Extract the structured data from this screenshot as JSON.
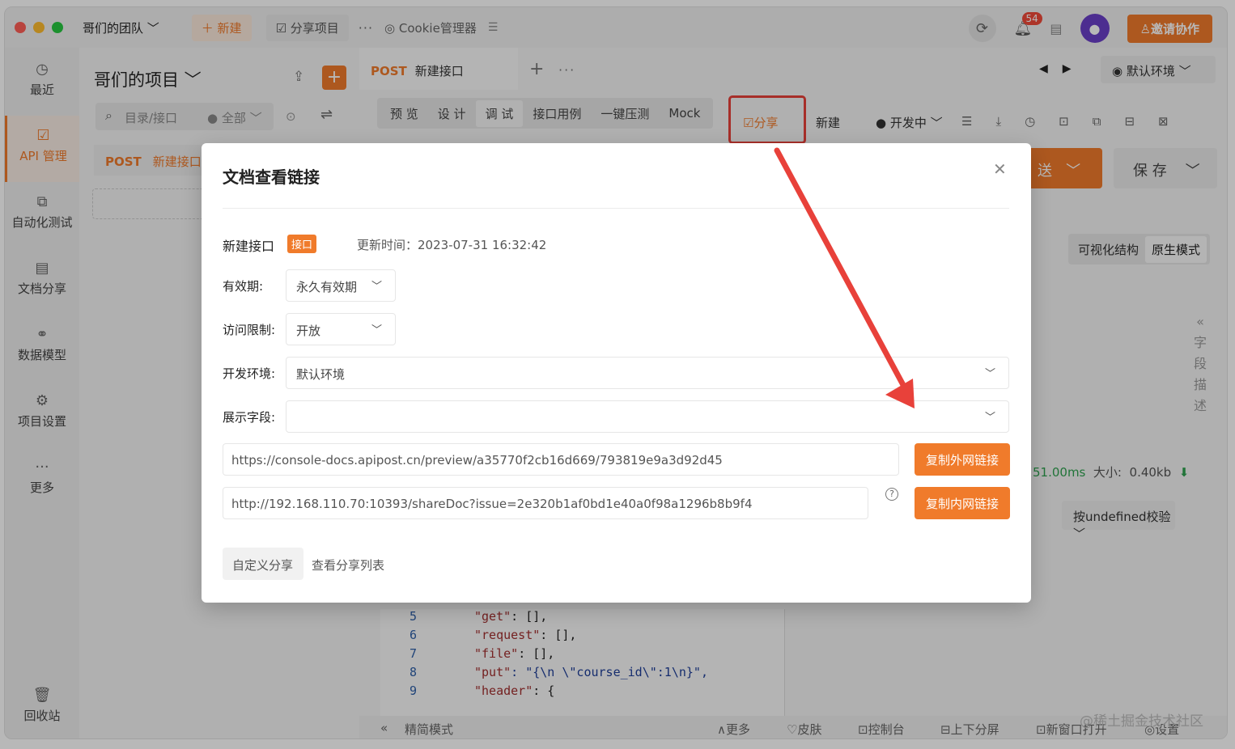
{
  "titlebar": {
    "team": "哥们的团队 ﹀",
    "new_label": "＋ 新建",
    "share_project": "☑ 分享项目",
    "more": "···",
    "cookie": "◎ Cookie管理器",
    "list_icon": "☰",
    "notifications": "54",
    "invite": "邀请协作"
  },
  "sidebar": {
    "items": [
      {
        "label": "最近",
        "icon": "clock-icon"
      },
      {
        "label": "API 管理",
        "icon": "edit-icon"
      },
      {
        "label": "自动化测试",
        "icon": "flow-icon"
      },
      {
        "label": "文档分享",
        "icon": "doc-icon"
      },
      {
        "label": "数据模型",
        "icon": "model-icon"
      },
      {
        "label": "项目设置",
        "icon": "settings-icon"
      },
      {
        "label": "更多",
        "icon": "more-icon"
      },
      {
        "label": "回收站",
        "icon": "trash-icon"
      }
    ]
  },
  "project": {
    "title": "哥们的项目 ﹀",
    "search_placeholder": "目录/接口",
    "filter": "● 全部 ﹀",
    "item_method": "POST",
    "item_name": "新建接口"
  },
  "main": {
    "tab_method": "POST",
    "tab_name": "新建接口",
    "env": "默认环境 ﹀",
    "subtabs": [
      "预 览",
      "设 计",
      "调 试",
      "接口用例",
      "一键压测",
      "Mock"
    ],
    "share": "分享",
    "new_short": "新建",
    "dev": "● 开发中 ﹀",
    "send": "送",
    "save": "保 存",
    "view_visual": "可视化结构",
    "view_raw": "原生模式",
    "field_desc": [
      "«",
      "字",
      "段",
      "描",
      "述"
    ],
    "time_value": "51.00ms",
    "size_label": "大小:",
    "size_value": "0.40kb",
    "validate": "按undefined校验 ﹀"
  },
  "code": {
    "lines": [
      {
        "n": "5",
        "key": "\"get\"",
        "rest": ": [],"
      },
      {
        "n": "6",
        "key": "\"request\"",
        "rest": ": [],"
      },
      {
        "n": "7",
        "key": "\"file\"",
        "rest": ": [],"
      },
      {
        "n": "8",
        "key": "\"put\"",
        "rest": ": \"{\\n \\\"course_id\\\":1\\n}\","
      },
      {
        "n": "9",
        "key": "\"header\"",
        "rest": ": {"
      }
    ]
  },
  "statusbar": {
    "simple": "精简模式",
    "more": "∧更多",
    "skin": "♡皮肤",
    "console": "⊡控制台",
    "split": "⊟上下分屏",
    "newwin": "⊡新窗口打开",
    "settings": "◎设置"
  },
  "watermark": "@稀土掘金技术社区",
  "modal": {
    "title": "文档查看链接",
    "api_name": "新建接口",
    "api_tag": "接口",
    "updated": "更新时间：2023-07-31 16:32:42",
    "validity_label": "有效期:",
    "validity_value": "永久有效期",
    "access_label": "访问限制:",
    "access_value": "开放",
    "env_label": "开发环境:",
    "env_value": "默认环境",
    "fields_label": "展示字段:",
    "fields_value": "",
    "external_url": "https://console-docs.apipost.cn/preview/a35770f2cb16d669/793819e9a3d92d45",
    "internal_url": "http://192.168.110.70:10393/shareDoc?issue=2e320b1af0bd1e40a0f98a1296b8b9f4",
    "copy_external": "复制外网链接",
    "copy_internal": "复制内网链接",
    "custom_share": "自定义分享",
    "view_list": "查看分享列表"
  },
  "colors": {
    "accent": "#f07b2b",
    "highlight": "#e8413a"
  }
}
